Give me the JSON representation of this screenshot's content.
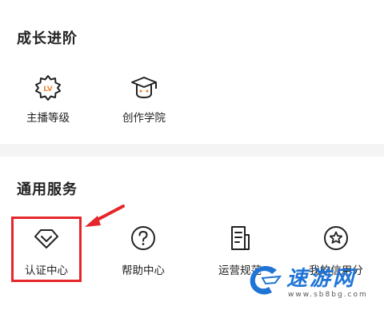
{
  "growth": {
    "title": "成长进阶",
    "items": [
      {
        "label": "主播等级",
        "icon": "level-badge-icon",
        "badge_text": "LV"
      },
      {
        "label": "创作学院",
        "icon": "graduation-cap-icon"
      }
    ]
  },
  "services": {
    "title": "通用服务",
    "items": [
      {
        "label": "认证中心",
        "icon": "diamond-icon"
      },
      {
        "label": "帮助中心",
        "icon": "question-circle-icon"
      },
      {
        "label": "运营规范",
        "icon": "document-icon"
      },
      {
        "label": "我的信用分",
        "icon": "star-circle-icon"
      }
    ]
  },
  "annotation": {
    "highlight_color": "#e5262a"
  },
  "watermark": {
    "text": "速游网",
    "url": "www.sb8bg.com",
    "color": "#1f74d6"
  }
}
